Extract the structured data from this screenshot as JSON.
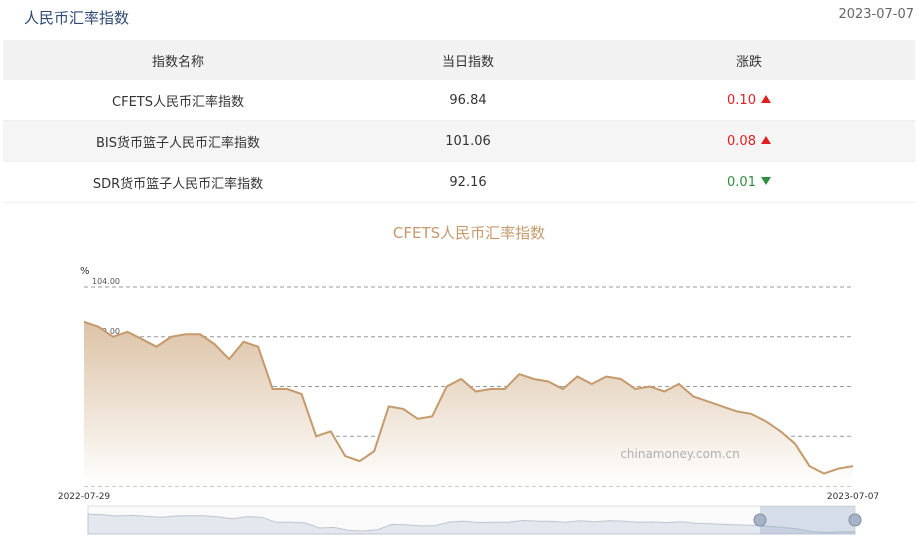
{
  "header": {
    "title": "人民币汇率指数",
    "date": "2023-07-07"
  },
  "table": {
    "columns": [
      "指数名称",
      "当日指数",
      "涨跌"
    ],
    "rows": [
      {
        "name": "CFETS人民币汇率指数",
        "value": "96.84",
        "change": "0.10",
        "direction": "up"
      },
      {
        "name": "BIS货币篮子人民币汇率指数",
        "value": "101.06",
        "change": "0.08",
        "direction": "up"
      },
      {
        "name": "SDR货币篮子人民币汇率指数",
        "value": "92.16",
        "change": "0.01",
        "direction": "down"
      }
    ]
  },
  "chart_data": {
    "type": "area",
    "title": "CFETS人民币汇率指数",
    "ylabel": "%",
    "ylim": [
      96,
      104
    ],
    "yticks": [
      "104.00",
      "102.00",
      "100.00",
      "98.00",
      "96.00"
    ],
    "x_start_label": "2022-07-29",
    "x_end_label": "2023-07-07",
    "watermark": "chinamoney.com.cn",
    "grid": true,
    "colors": {
      "line": "#c9a27a",
      "fill_top": "#dcc3a6",
      "fill_bottom": "#ffffff"
    },
    "values": [
      102.6,
      102.4,
      102.0,
      102.2,
      101.9,
      101.6,
      102.0,
      102.1,
      102.1,
      101.7,
      101.1,
      101.8,
      101.6,
      99.9,
      99.9,
      99.7,
      98.0,
      98.2,
      97.2,
      97.0,
      97.4,
      99.2,
      99.1,
      98.7,
      98.8,
      100.0,
      100.3,
      99.8,
      99.9,
      99.9,
      100.5,
      100.3,
      100.2,
      99.9,
      100.4,
      100.1,
      100.4,
      100.3,
      99.9,
      100.0,
      99.8,
      100.1,
      99.6,
      99.4,
      99.2,
      99.0,
      98.9,
      98.6,
      98.2,
      97.7,
      96.8,
      96.5,
      96.7,
      96.8
    ]
  }
}
